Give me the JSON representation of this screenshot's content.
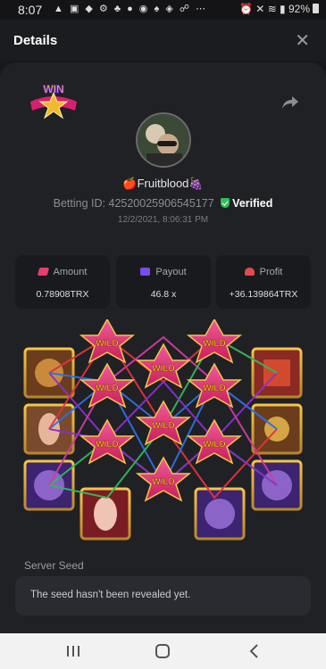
{
  "status_bar": {
    "time": "8:07",
    "battery": "92%"
  },
  "header": {
    "title": "Details"
  },
  "user": {
    "username": "🍎Fruitblood🍇",
    "betting_id_label": "Betting ID:",
    "betting_id": "425200259065451​77",
    "verified_label": "Verified",
    "timestamp": "12/2/2021, 8:06:31 PM"
  },
  "stats": [
    {
      "label": "Amount",
      "value": "0.78908TRX",
      "color": "#e63e6d"
    },
    {
      "label": "Payout",
      "value": "46.8 x",
      "color": "#7a4cf0"
    },
    {
      "label": "Profit",
      "value": "+36.139864TRX",
      "color": "#e14b4b"
    }
  ],
  "board": {
    "badge_text": "WIN",
    "tile_text": "WILD",
    "line_colors": [
      "#e0343c",
      "#2f6fe0",
      "#34b85a",
      "#8a2fd0",
      "#d03ca0"
    ]
  },
  "server_seed": {
    "label": "Server Seed",
    "message": "The seed hasn't been revealed yet."
  }
}
